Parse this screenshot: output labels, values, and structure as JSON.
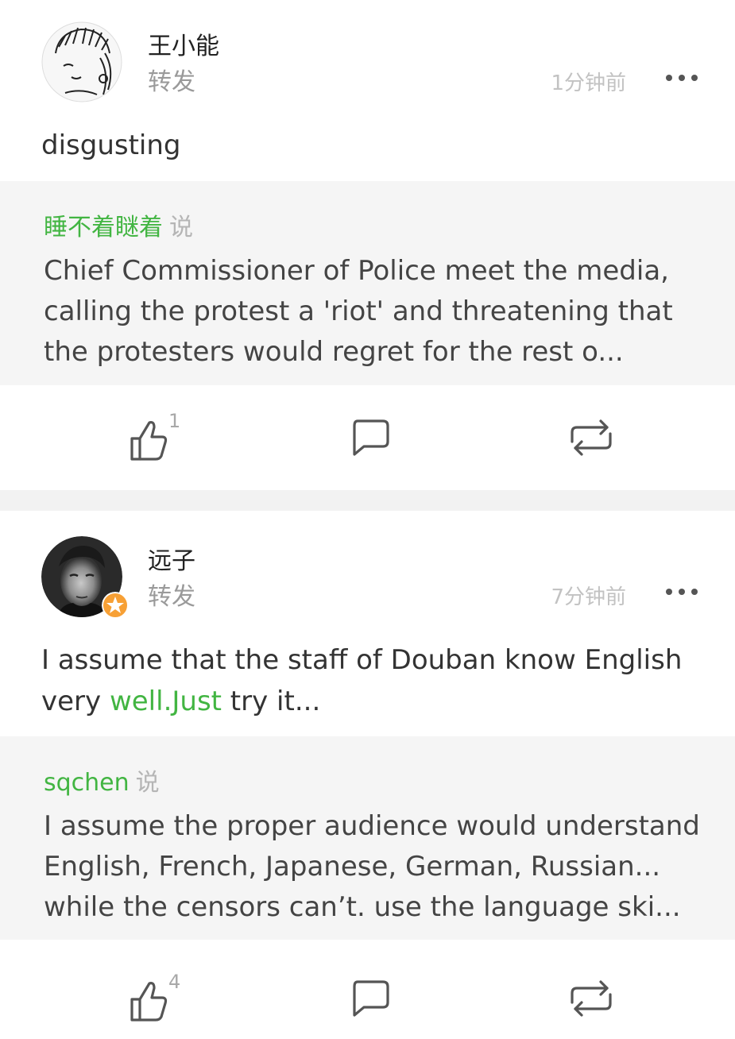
{
  "posts": [
    {
      "author": "王小能",
      "action": "转发",
      "time": "1分钟前",
      "text_parts": [
        "disgusting"
      ],
      "quote": {
        "author": "睡不着瞇着",
        "says": "说",
        "text": "Chief Commissioner of Police meet the media, calling the protest a 'riot' and threatening that the protesters would regret for the rest o..."
      },
      "likes": "1",
      "icons": {
        "avatar": "cartoon-girl-avatar",
        "more": "more-dots-icon",
        "like": "thumbs-up-icon",
        "comment": "comment-bubble-icon",
        "repost": "repost-arrows-icon"
      }
    },
    {
      "author": "远子",
      "action": "转发",
      "time": "7分钟前",
      "text_parts": [
        "I assume that the staff of Douban know English very ",
        "well.Just",
        " try it..."
      ],
      "quote": {
        "author": "sqchen",
        "says": "说",
        "text": "I assume the proper audience would understand English, French, Japanese, German, Russian... while the censors can’t. use the language ski..."
      },
      "likes": "4",
      "icons": {
        "avatar": "portrait-man-avatar",
        "badge": "star-badge-icon",
        "more": "more-dots-icon",
        "like": "thumbs-up-icon",
        "comment": "comment-bubble-icon",
        "repost": "repost-arrows-icon"
      }
    }
  ],
  "colors": {
    "accent_green": "#42b542",
    "muted_gray": "#9a9a9a",
    "timestamp_gray": "#c2c2c2",
    "quote_bg": "#f5f5f5",
    "separator": "#f2f2f2",
    "badge_orange": "#f7a035"
  }
}
